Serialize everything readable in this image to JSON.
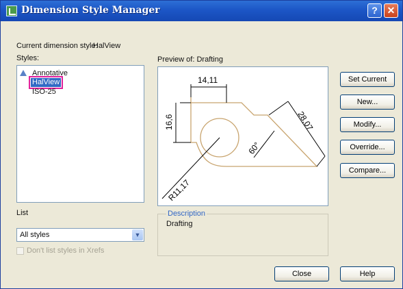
{
  "window": {
    "title": "Dimension Style Manager",
    "help_glyph": "?",
    "close_glyph": "✕"
  },
  "current_style": {
    "label": "Current dimension style:",
    "value": "HalView"
  },
  "styles": {
    "label": "Styles:",
    "items": [
      {
        "label": "Annotative",
        "icon": "annotative-icon"
      },
      {
        "label": "HalView",
        "selected": true
      },
      {
        "label": "ISO-25"
      }
    ]
  },
  "list": {
    "label": "List",
    "selected": "All styles",
    "dropdown_glyph": "▼"
  },
  "xref_checkbox": {
    "label": "Don't list styles in Xrefs",
    "checked": false,
    "enabled": false
  },
  "preview": {
    "label": "Preview of: Drafting",
    "dims": {
      "top": "14,11",
      "left": "16,6",
      "right": "28,07",
      "angle": "60°",
      "radius": "R11,17"
    }
  },
  "description": {
    "legend": "Description",
    "text": "Drafting"
  },
  "buttons": {
    "set_current": "Set Current",
    "new": "New...",
    "modify": "Modify...",
    "override": "Override...",
    "compare": "Compare...",
    "close": "Close",
    "help": "Help"
  },
  "colors": {
    "titlebar": "#1c56c6",
    "selection": "#316ac5",
    "highlight_border": "#e0219a",
    "drawing_line": "#c8a46e",
    "dim_line": "#000000"
  }
}
